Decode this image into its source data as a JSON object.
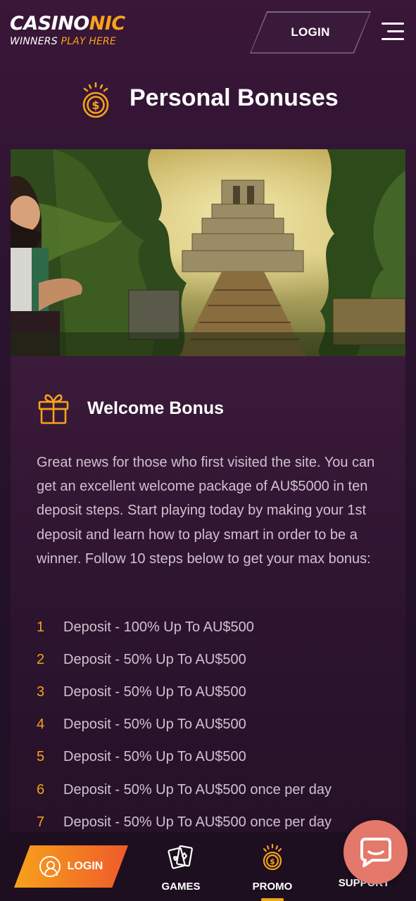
{
  "header": {
    "logo_main": "CASINO",
    "logo_main_accent": "NIC",
    "logo_sub": "WINNERS ",
    "logo_sub_accent": "PLAY HERE",
    "login_label": "LOGIN",
    "menu_icon": "hamburger-menu-icon"
  },
  "page": {
    "title": "Personal Bonuses",
    "title_icon": "coin-crown-icon"
  },
  "banner": {
    "image": "jungle-temple-banner"
  },
  "welcome": {
    "icon": "gift-icon",
    "title": "Welcome Bonus",
    "text": "Great news for those who first visited the site. You can get an excellent welcome package of AU$5000 in ten deposit steps. Start playing today by making your 1st deposit and learn how to play smart in order to be a winner. Follow 10 steps below to get your max bonus:",
    "steps": [
      {
        "num": "1",
        "text": "Deposit - 100% Up To AU$500"
      },
      {
        "num": "2",
        "text": "Deposit - 50% Up To AU$500"
      },
      {
        "num": "3",
        "text": "Deposit - 50% Up To AU$500"
      },
      {
        "num": "4",
        "text": "Deposit - 50% Up To AU$500"
      },
      {
        "num": "5",
        "text": "Deposit - 50% Up To AU$500"
      },
      {
        "num": "6",
        "text": "Deposit - 50% Up To AU$500 once per day"
      },
      {
        "num": "7",
        "text": "Deposit - 50% Up To AU$500 once per day"
      }
    ]
  },
  "bottom_nav": {
    "login": "LOGIN",
    "games": "GAMES",
    "promo": "PROMO",
    "support": "SUPPORT",
    "active": "PROMO"
  },
  "colors": {
    "accent": "#f7a21b",
    "accent_end": "#ef5a2a",
    "background": "#2c1430",
    "chat": "#e4786a"
  }
}
